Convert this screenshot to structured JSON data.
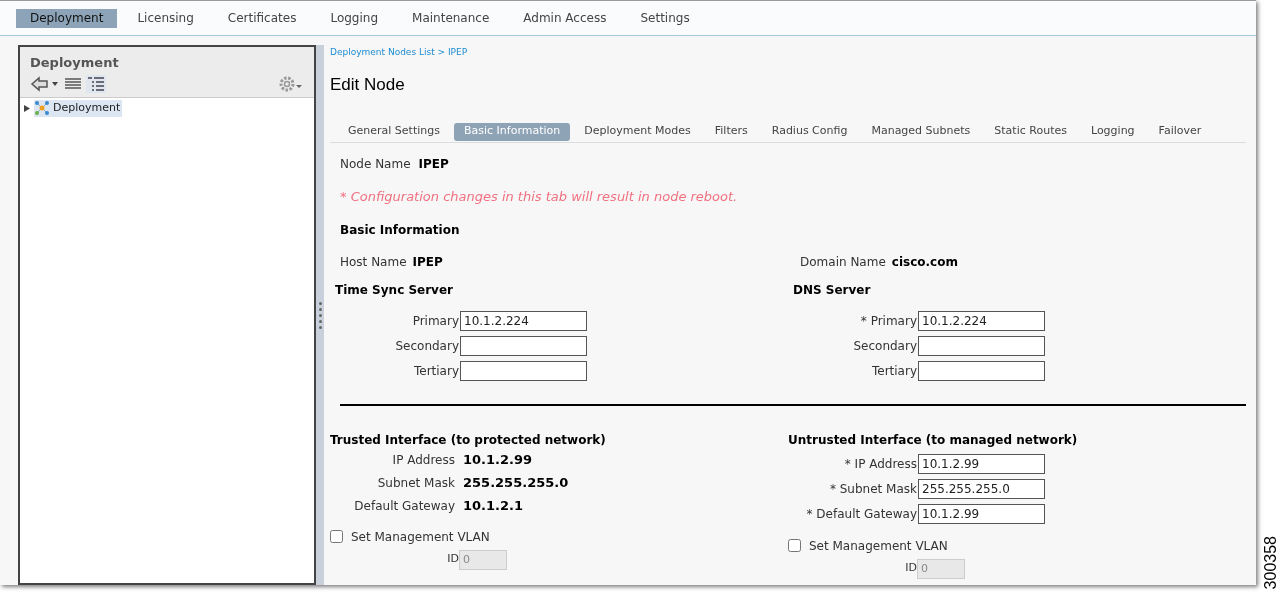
{
  "top_nav": [
    {
      "label": "Deployment",
      "selected": true
    },
    {
      "label": "Licensing",
      "selected": false
    },
    {
      "label": "Certificates",
      "selected": false
    },
    {
      "label": "Logging",
      "selected": false
    },
    {
      "label": "Maintenance",
      "selected": false
    },
    {
      "label": "Admin Access",
      "selected": false
    },
    {
      "label": "Settings",
      "selected": false
    }
  ],
  "left_panel": {
    "title": "Deployment",
    "tree": [
      {
        "label": "Deployment",
        "expanded": false,
        "selected": true
      }
    ]
  },
  "breadcrumb": "Deployment Nodes List > IPEP",
  "page_title": "Edit Node",
  "tabs": [
    {
      "label": "General Settings",
      "selected": false
    },
    {
      "label": "Basic Information",
      "selected": true
    },
    {
      "label": "Deployment Modes",
      "selected": false
    },
    {
      "label": "Filters",
      "selected": false
    },
    {
      "label": "Radius Config",
      "selected": false
    },
    {
      "label": "Managed Subnets",
      "selected": false
    },
    {
      "label": "Static Routes",
      "selected": false
    },
    {
      "label": "Logging",
      "selected": false
    },
    {
      "label": "Failover",
      "selected": false
    }
  ],
  "node_name": {
    "label": "Node Name",
    "value": "IPEP"
  },
  "warning": "* Configuration changes in this tab will result in node reboot.",
  "basic_information": {
    "title": "Basic Information",
    "host_name": {
      "label": "Host Name",
      "value": "IPEP"
    },
    "domain_name": {
      "label": "Domain Name",
      "value": "cisco.com"
    }
  },
  "time_sync_server": {
    "title": "Time Sync Server",
    "fields": [
      {
        "label": "Primary",
        "value": "10.1.2.224"
      },
      {
        "label": "Secondary"
      },
      {
        "label": "Tertiary"
      }
    ]
  },
  "dns_server": {
    "title": "DNS Server",
    "fields": [
      {
        "label": "* Primary",
        "value": "10.1.2.224"
      },
      {
        "label": "Secondary"
      },
      {
        "label": "Tertiary"
      }
    ]
  },
  "trusted_interface": {
    "title": "Trusted Interface (to protected network)",
    "rows": [
      {
        "label": "IP Address",
        "value": "10.1.2.99"
      },
      {
        "label": "Subnet Mask",
        "value": "255.255.255.0"
      },
      {
        "label": "Default Gateway",
        "value": "10.1.2.1"
      }
    ],
    "vlan": {
      "label": "Set Management VLAN",
      "checked": false
    },
    "id": {
      "label": "ID",
      "value": "0",
      "disabled": true
    }
  },
  "untrusted_interface": {
    "title": "Untrusted Interface (to managed network)",
    "fields": [
      {
        "label": "* IP Address",
        "value": "10.1.2.99"
      },
      {
        "label": "* Subnet Mask",
        "value": "255.255.255.0"
      },
      {
        "label": "* Default Gateway",
        "value": "10.1.2.99"
      }
    ],
    "vlan": {
      "label": "Set Management VLAN",
      "checked": false
    },
    "id": {
      "label": "ID",
      "value": "0",
      "disabled": true
    }
  },
  "figure_number": "300358"
}
